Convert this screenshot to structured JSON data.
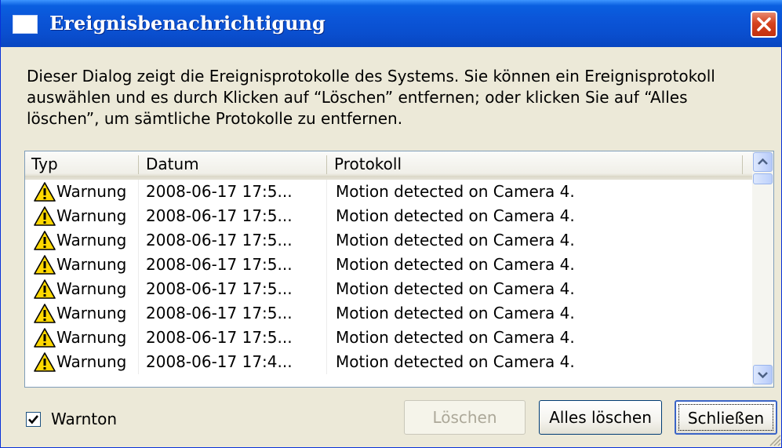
{
  "window": {
    "title": "Ereignisbenachrichtigung",
    "description": "Dieser Dialog zeigt die Ereignisprotokolle des Systems. Sie können ein Ereignisprotokoll auswählen und es durch Klicken auf “Löschen” entfernen; oder klicken Sie auf “Alles löschen”, um sämtliche Protokolle zu entfernen."
  },
  "list": {
    "columns": [
      "Typ",
      "Datum",
      "Protokoll"
    ],
    "rows": [
      {
        "type": "Warnung",
        "date": "2008-06-17 17:5...",
        "log": "Motion detected on Camera 4.",
        "icon": "warning-icon"
      },
      {
        "type": "Warnung",
        "date": "2008-06-17 17:5...",
        "log": "Motion detected on Camera 4.",
        "icon": "warning-icon"
      },
      {
        "type": "Warnung",
        "date": "2008-06-17 17:5...",
        "log": "Motion detected on Camera 4.",
        "icon": "warning-icon"
      },
      {
        "type": "Warnung",
        "date": "2008-06-17 17:5...",
        "log": "Motion detected on Camera 4.",
        "icon": "warning-icon"
      },
      {
        "type": "Warnung",
        "date": "2008-06-17 17:5...",
        "log": "Motion detected on Camera 4.",
        "icon": "warning-icon"
      },
      {
        "type": "Warnung",
        "date": "2008-06-17 17:5...",
        "log": "Motion detected on Camera 4.",
        "icon": "warning-icon"
      },
      {
        "type": "Warnung",
        "date": "2008-06-17 17:5...",
        "log": "Motion detected on Camera 4.",
        "icon": "warning-icon"
      },
      {
        "type": "Warnung",
        "date": "2008-06-17 17:4...",
        "log": "Motion detected on Camera 4.",
        "icon": "warning-icon"
      }
    ]
  },
  "footer": {
    "checkbox_label": "Warnton",
    "checkbox_checked": true,
    "delete_label": "Löschen",
    "delete_all_label": "Alles löschen",
    "close_label": "Schließen"
  },
  "colors": {
    "titlebar": "#0a5fe0",
    "close_button": "#d5431e",
    "dialog_background": "#ece9d8",
    "warning_yellow": "#ffd800"
  }
}
